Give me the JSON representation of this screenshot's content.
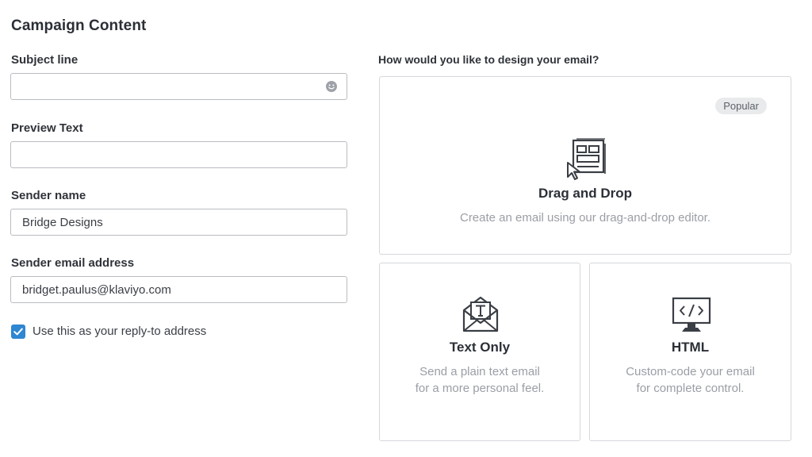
{
  "page": {
    "title": "Campaign Content"
  },
  "form": {
    "subject": {
      "label": "Subject line",
      "value": "",
      "placeholder": ""
    },
    "preview": {
      "label": "Preview Text",
      "value": "",
      "placeholder": ""
    },
    "sender_name": {
      "label": "Sender name",
      "value": "Bridge Designs"
    },
    "sender_email": {
      "label": "Sender email address",
      "value": "bridget.paulus@klaviyo.com"
    },
    "reply_to": {
      "label": "Use this as your reply-to address",
      "checked": true
    }
  },
  "design": {
    "question": "How would you like to design your email?",
    "options": [
      {
        "id": "drag-drop",
        "title": "Drag and Drop",
        "description": "Create an email using our drag-and-drop editor.",
        "badge": "Popular",
        "icon": "drag-drop-icon"
      },
      {
        "id": "text-only",
        "title": "Text Only",
        "description": "Send a plain text email for a more personal feel.",
        "icon": "text-envelope-icon"
      },
      {
        "id": "html",
        "title": "HTML",
        "description": "Custom-code your email for complete control.",
        "icon": "code-monitor-icon"
      }
    ]
  },
  "colors": {
    "accent": "#2f86d1",
    "border": "#d5d8dc",
    "muted_text": "#9a9ea5"
  }
}
